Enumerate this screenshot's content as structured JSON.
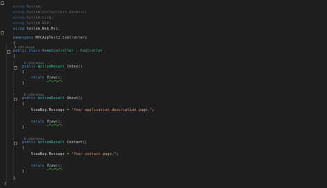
{
  "editor": {
    "usings": [
      {
        "kw": "using",
        "ns": "System;",
        "dim": true
      },
      {
        "kw": "using",
        "ns": "System.Collections.Generic;",
        "dim": true
      },
      {
        "kw": "using",
        "ns": "System.Linq;",
        "dim": true
      },
      {
        "kw": "using",
        "ns": "System.Web;",
        "dim": true
      },
      {
        "kw": "using",
        "ns": "System.Web.Mvc;",
        "dim": false
      }
    ],
    "namespace_kw": "namespace",
    "namespace_name": "MVCAppTest2.Controllers",
    "open_brace": "{",
    "close_brace": "}",
    "class_refs": "0 references",
    "class_public": "public",
    "class_kw": "class",
    "class_name": "HomeController",
    "class_colon": ":",
    "class_base": "Controller",
    "methods": [
      {
        "refs": "0 references",
        "public": "public",
        "return_type": "ActionResult",
        "name": "Index()",
        "viewbag": null,
        "return_kw": "return",
        "return_call": "View();"
      },
      {
        "refs": "0 references",
        "public": "public",
        "return_type": "ActionResult",
        "name": "About()",
        "viewbag_lhs": "ViewBag.Message =",
        "viewbag_str": "\"Your application description page.\"",
        "viewbag_end": ";",
        "return_kw": "return",
        "return_call": "View();"
      },
      {
        "refs": "0 references",
        "public": "public",
        "return_type": "ActionResult",
        "name": "Contact()",
        "viewbag_lhs": "ViewBag.Message =",
        "viewbag_str": "\"Your contact page.\"",
        "viewbag_end": ";",
        "return_kw": "return",
        "return_call": "View();"
      }
    ]
  },
  "colors": {
    "background": "#1e1e1e",
    "keyword": "#569cd6",
    "type": "#4ec9b0",
    "string": "#d69d85",
    "text": "#d4d4d4"
  }
}
